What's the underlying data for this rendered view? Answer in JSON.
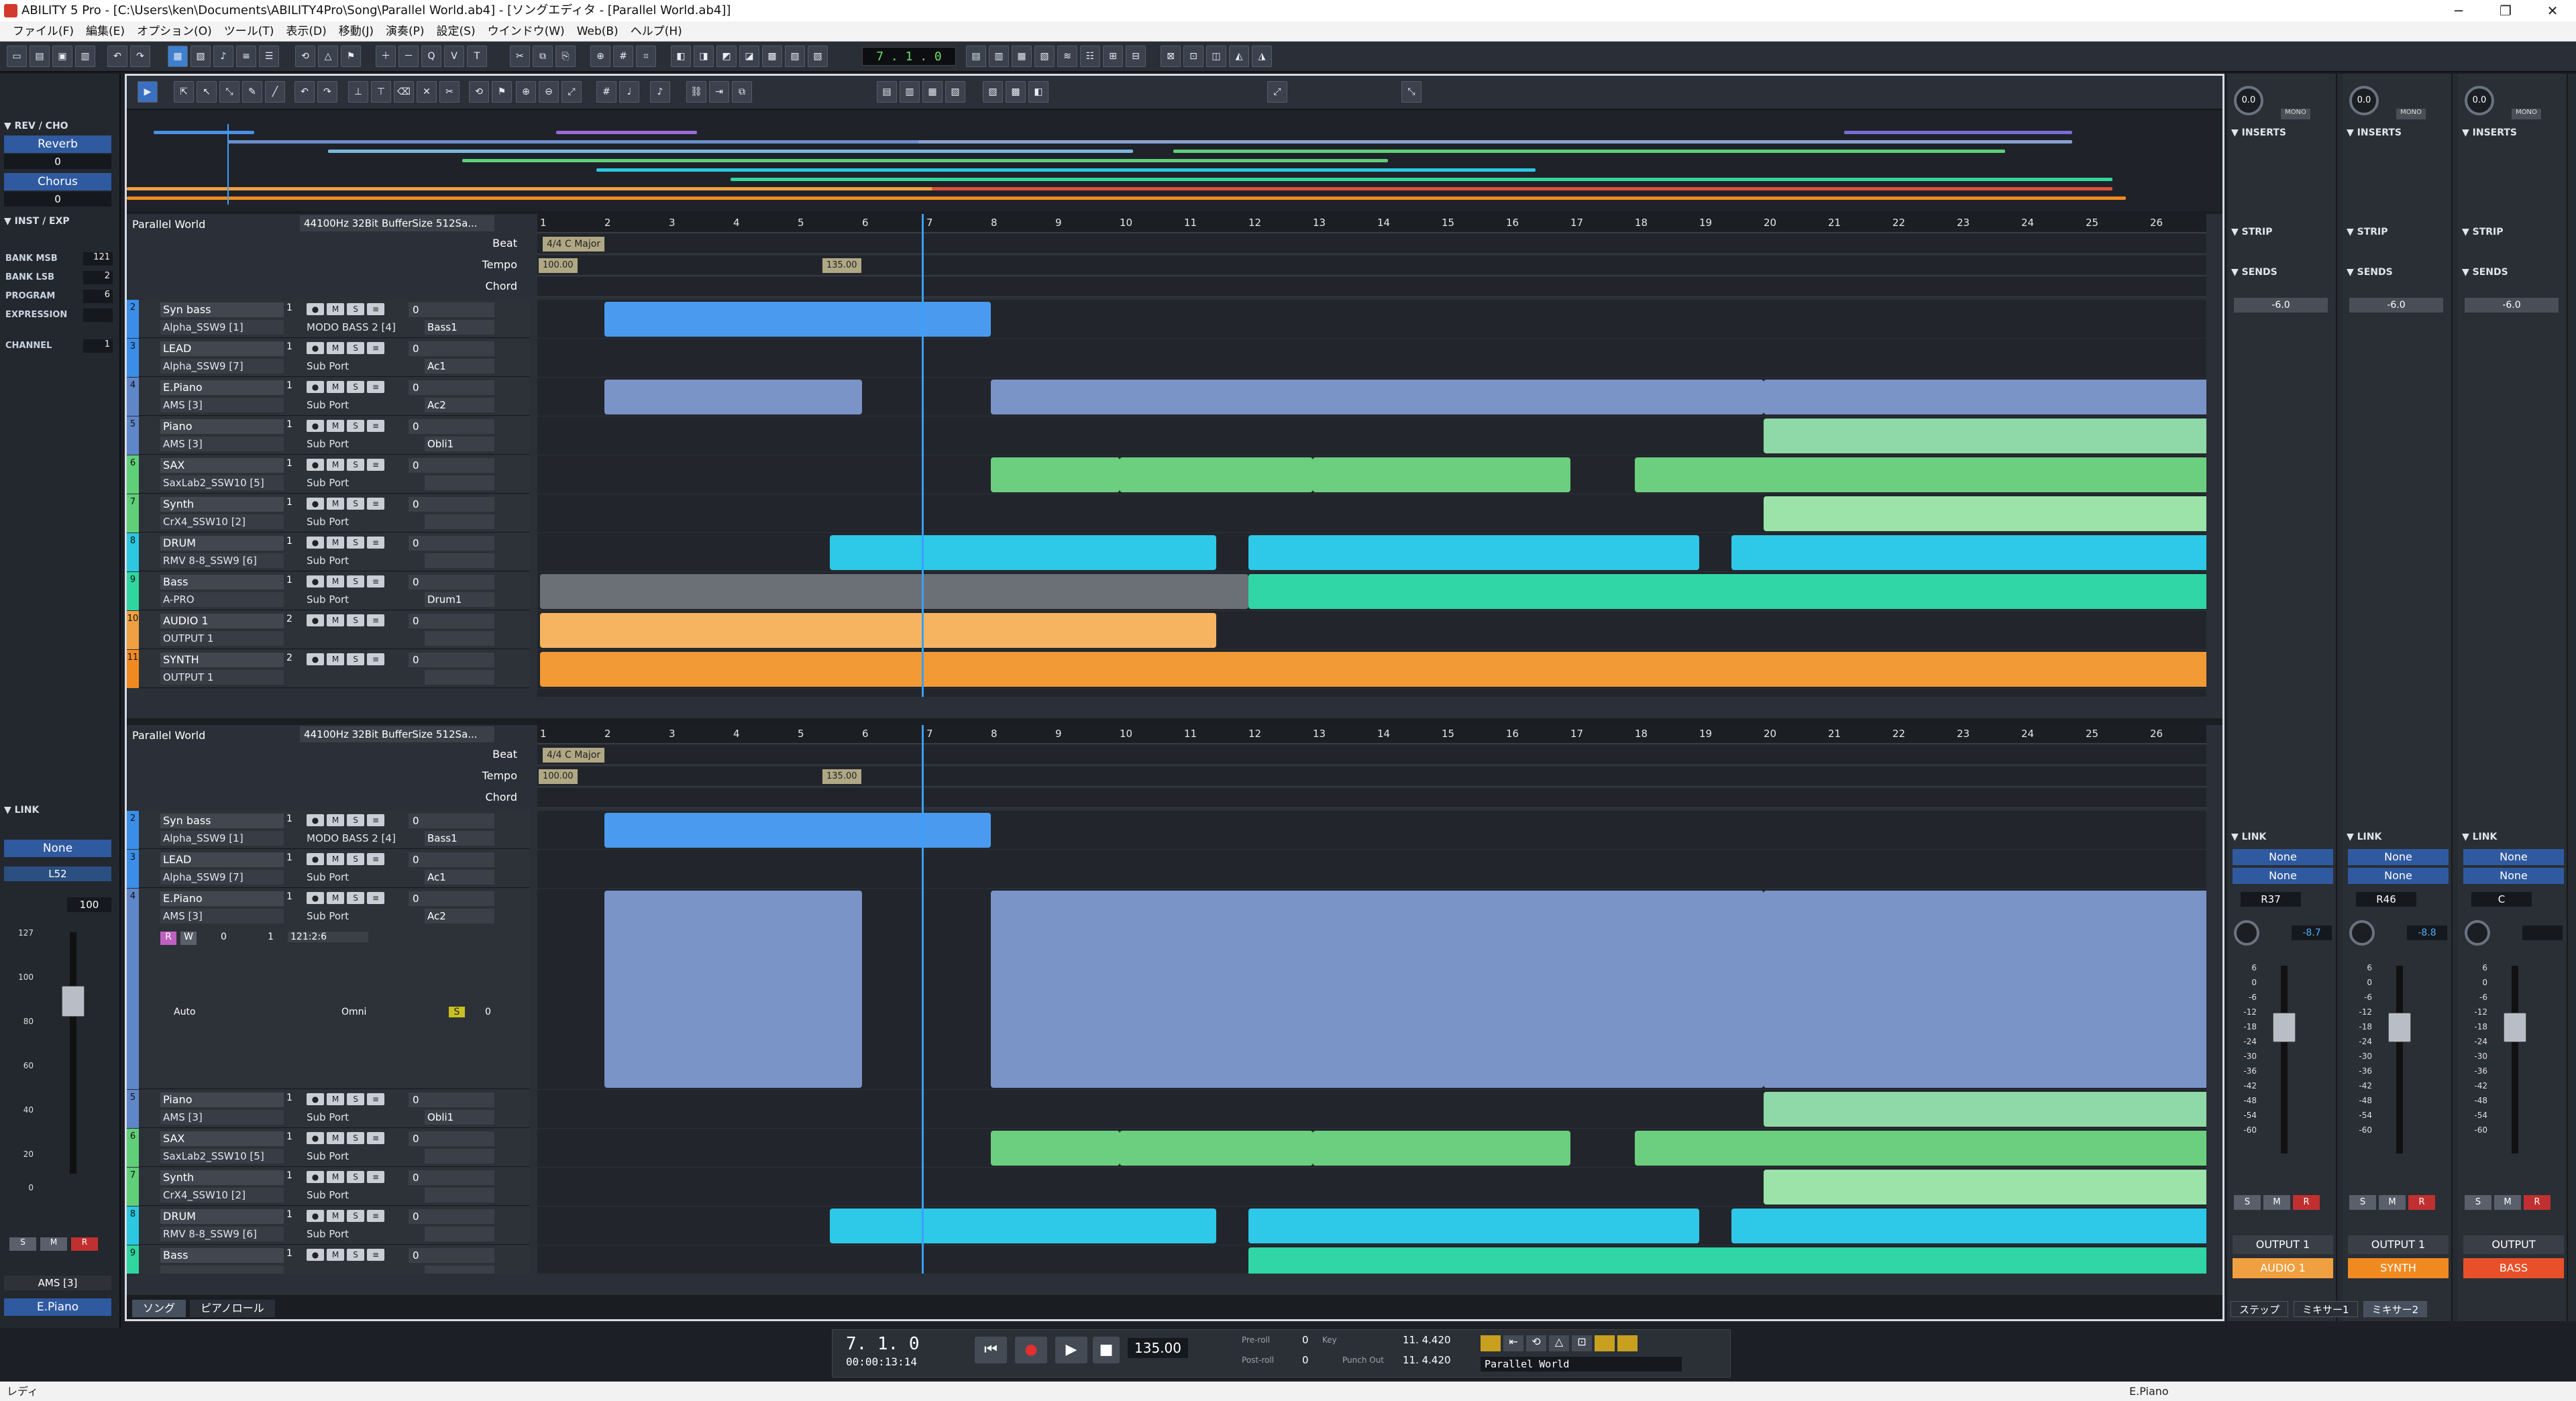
{
  "window": {
    "title": "ABILITY 5 Pro - [C:\\Users\\ken\\Documents\\ABILITY4Pro\\Song\\Parallel World.ab4] - [ソングエディタ - [Parallel World.ab4]]"
  },
  "menu": [
    "ファイル(F)",
    "編集(E)",
    "オプション(O)",
    "ツール(T)",
    "表示(D)",
    "移動(J)",
    "演奏(P)",
    "設定(S)",
    "ウインドウ(W)",
    "Web(B)",
    "ヘルプ(H)"
  ],
  "toolbar": {
    "counter": "7 . 1 . 0"
  },
  "left_panel": {
    "rev_cho_title": "REV / CHO",
    "reverb_label": "Reverb",
    "reverb_value": "0",
    "chorus_label": "Chorus",
    "chorus_value": "0",
    "inst_title": "INST / EXP",
    "bank_msb_label": "BANK MSB",
    "bank_msb": "121",
    "bank_lsb_label": "BANK LSB",
    "bank_lsb": "2",
    "program_label": "PROGRAM",
    "program": "6",
    "expression_label": "EXPRESSION",
    "channel_label": "CHANNEL",
    "channel": "1",
    "link_title": "LINK",
    "link_none": "None",
    "link_l52": "L52",
    "velocity": "100",
    "scale": [
      "127",
      "100",
      "80",
      "60",
      "40",
      "20",
      "0"
    ],
    "ams": "AMS [3]",
    "epiano": "E.Piano"
  },
  "song": {
    "name": "Parallel World",
    "info": "44100Hz 32Bit BufferSize 512Sa...",
    "meta_rows": [
      "Beat",
      "Tempo",
      "Chord"
    ],
    "time_signature": "4/4 C Major",
    "tempo_start": "100.00",
    "tempo_change": "135.00",
    "bars": [
      "1",
      "2",
      "3",
      "4",
      "5",
      "6",
      "7",
      "8",
      "9",
      "10",
      "11",
      "12",
      "13",
      "14",
      "15",
      "16",
      "17",
      "18",
      "19",
      "20",
      "21",
      "22",
      "23",
      "24",
      "25",
      "26"
    ]
  },
  "tracks_top": [
    {
      "num": "2",
      "name": "Syn bass",
      "ch": "1",
      "dev": "Alpha_SSW9 [1]",
      "port": "MODO BASS 2 [4]",
      "prog": "Bass1",
      "vol": "0",
      "color": "#3a8ee8"
    },
    {
      "num": "3",
      "name": "LEAD",
      "ch": "1",
      "dev": "Alpha_SSW9 [7]",
      "port": "Sub Port",
      "prog": "Ac1",
      "vol": "0",
      "color": "#3a8ee8"
    },
    {
      "num": "4",
      "name": "E.Piano",
      "ch": "1",
      "dev": "AMS [3]",
      "port": "Sub Port",
      "prog": "Ac2",
      "vol": "0",
      "color": "#5f86c8"
    },
    {
      "num": "5",
      "name": "Piano",
      "ch": "1",
      "dev": "AMS [3]",
      "port": "Sub Port",
      "prog": "Obli1",
      "vol": "0",
      "color": "#5f86c8"
    },
    {
      "num": "6",
      "name": "SAX",
      "ch": "1",
      "dev": "SaxLab2_SSW10 [5]",
      "port": "Sub Port",
      "prog": "",
      "vol": "0",
      "color": "#5fcf78"
    },
    {
      "num": "7",
      "name": "Synth",
      "ch": "1",
      "dev": "CrX4_SSW10 [2]",
      "port": "Sub Port",
      "prog": "",
      "vol": "0",
      "color": "#5fcf78"
    },
    {
      "num": "8",
      "name": "DRUM",
      "ch": "1",
      "dev": "RMV 8-8_SSW9 [6]",
      "port": "Sub Port",
      "prog": "",
      "vol": "0",
      "color": "#2bc8e0"
    },
    {
      "num": "9",
      "name": "Bass",
      "ch": "1",
      "dev": "A-PRO",
      "port": "Sub Port",
      "prog": "Drum1",
      "vol": "0",
      "color": "#2fd6a0"
    },
    {
      "num": "10",
      "name": "AUDIO 1",
      "ch": "2",
      "dev": "OUTPUT 1",
      "port": "",
      "prog": "",
      "vol": "0",
      "color": "#f0a040"
    },
    {
      "num": "11",
      "name": "SYNTH",
      "ch": "2",
      "dev": "OUTPUT 1",
      "port": "",
      "prog": "",
      "vol": "0",
      "color": "#f08a20"
    }
  ],
  "tracks_bottom": [
    {
      "num": "2",
      "name": "Syn bass",
      "ch": "1",
      "dev": "Alpha_SSW9 [1]",
      "port": "MODO BASS 2 [4]",
      "prog": "Bass1",
      "vol": "0",
      "color": "#3a8ee8"
    },
    {
      "num": "3",
      "name": "LEAD",
      "ch": "1",
      "dev": "Alpha_SSW9 [7]",
      "port": "Sub Port",
      "prog": "Ac1",
      "vol": "0",
      "color": "#3a8ee8"
    },
    {
      "num": "4",
      "name": "E.Piano",
      "ch": "1",
      "dev": "AMS [3]",
      "port": "Sub Port",
      "prog": "Ac2",
      "vol": "0",
      "color": "#5f86c8"
    },
    {
      "num": "5",
      "name": "Piano",
      "ch": "1",
      "dev": "AMS [3]",
      "port": "Sub Port",
      "prog": "Obli1",
      "vol": "0",
      "color": "#5f86c8"
    },
    {
      "num": "6",
      "name": "SAX",
      "ch": "1",
      "dev": "SaxLab2_SSW10 [5]",
      "port": "Sub Port",
      "prog": "",
      "vol": "0",
      "color": "#5fcf78"
    },
    {
      "num": "7",
      "name": "Synth",
      "ch": "1",
      "dev": "CrX4_SSW10 [2]",
      "port": "Sub Port",
      "prog": "",
      "vol": "0",
      "color": "#5fcf78"
    },
    {
      "num": "8",
      "name": "DRUM",
      "ch": "1",
      "dev": "RMV 8-8_SSW9 [6]",
      "port": "Sub Port",
      "prog": "",
      "vol": "0",
      "color": "#2bc8e0"
    },
    {
      "num": "9",
      "name": "Bass",
      "ch": "1",
      "dev": "",
      "port": "",
      "prog": "",
      "vol": "0",
      "color": "#2fd6a0"
    }
  ],
  "expanded_track": {
    "record": "R",
    "write": "W",
    "offset": "0",
    "range": "1",
    "position": "121:2:6",
    "auto": "Auto",
    "omni": "Omni",
    "sf": "0"
  },
  "editor_tabs": [
    "ソング",
    "ピアノロール"
  ],
  "mixer": {
    "strips": [
      {
        "pan": "0.0",
        "send": "-6.0",
        "link1": "None",
        "link2": "None",
        "route": "R37",
        "level": "-8.7",
        "output": "OUTPUT 1",
        "track": "AUDIO 1",
        "track_color": "#f0a040"
      },
      {
        "pan": "0.0",
        "send": "-6.0",
        "link1": "None",
        "link2": "None",
        "route": "R46",
        "level": "-8.8",
        "output": "OUTPUT 1",
        "track": "SYNTH",
        "track_color": "#f08a20"
      },
      {
        "pan": "0.0",
        "send": "-6.0",
        "link1": "None",
        "link2": "None",
        "route": "C",
        "level": "",
        "output": "OUTPUT",
        "track": "BASS",
        "track_color": "#e8502a"
      }
    ],
    "section_inserts": "INSERTS",
    "section_strip": "STRIP",
    "section_sends": "SENDS",
    "section_link": "LINK",
    "scale": [
      "6",
      "0",
      "-6",
      "-12",
      "-18",
      "-24",
      "-30",
      "-36",
      "-42",
      "-48",
      "-54",
      "-60"
    ],
    "mono_label": "MONO",
    "tabs": [
      "ステップ",
      "ミキサー1",
      "ミキサー2"
    ]
  },
  "transport": {
    "position": "7. 1. 0",
    "time": "00:00:13:14",
    "tempo": "135.00",
    "pre_roll_label": "Pre-roll",
    "pre_roll": "0",
    "post_roll_label": "Post-roll",
    "post_roll": "0",
    "punch_in_label": "Punch In",
    "punch_in": "11. 4.420",
    "punch_out_label": "Punch Out",
    "punch_out": "11. 4.420",
    "key_label": "Key",
    "song_name": "Parallel World"
  },
  "status": {
    "left": "レディ",
    "right": "E.Piano"
  }
}
